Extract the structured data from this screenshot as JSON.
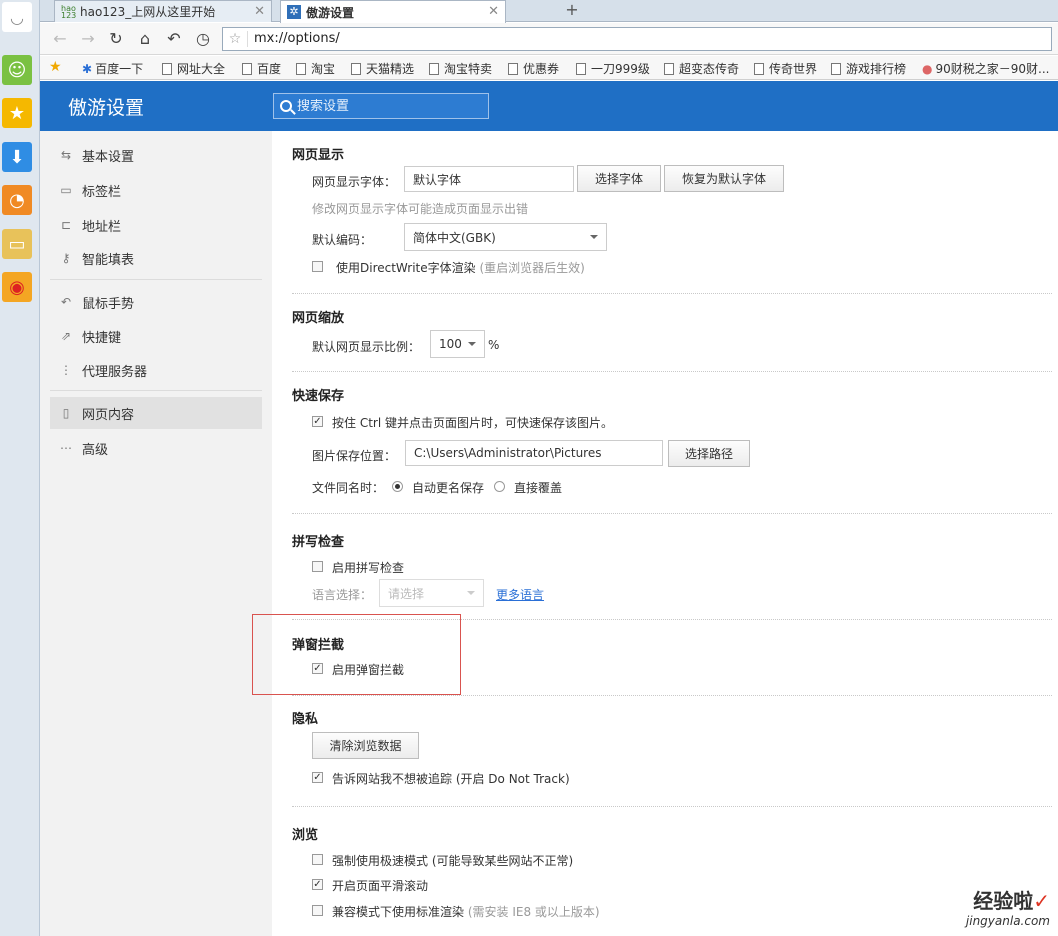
{
  "tabs": [
    {
      "label": "hao123_上网从这里开始",
      "icon": "hao123-icon"
    },
    {
      "label": "傲游设置",
      "icon": "maxthon-settings-icon"
    }
  ],
  "address": {
    "url": "mx://options/"
  },
  "bookmarks": [
    "百度一下",
    "网址大全",
    "百度",
    "淘宝",
    "天猫精选",
    "淘宝特卖",
    "优惠券",
    "一刀999级",
    "超变态传奇",
    "传奇世界",
    "游戏排行榜",
    "90财税之家－90财..."
  ],
  "header": {
    "title": "傲游设置",
    "search_placeholder": "搜索设置"
  },
  "sidebar": {
    "items": [
      {
        "label": "基本设置",
        "icon": "sliders-icon"
      },
      {
        "label": "标签栏",
        "icon": "tabs-icon"
      },
      {
        "label": "地址栏",
        "icon": "address-icon"
      },
      {
        "label": "智能填表",
        "icon": "key-icon"
      },
      {
        "label": "鼠标手势",
        "icon": "gesture-icon"
      },
      {
        "label": "快捷键",
        "icon": "shortcut-icon"
      },
      {
        "label": "代理服务器",
        "icon": "proxy-icon"
      },
      {
        "label": "网页内容",
        "icon": "page-icon"
      },
      {
        "label": "高级",
        "icon": "more-icon"
      }
    ]
  },
  "display": {
    "title": "网页显示",
    "font_label": "网页显示字体：",
    "font_value": "默认字体",
    "choose_font": "选择字体",
    "reset_font": "恢复为默认字体",
    "font_hint": "修改网页显示字体可能造成页面显示出错",
    "encoding_label": "默认编码：",
    "encoding_value": "简体中文(GBK)",
    "directwrite_label": "使用DirectWrite字体渲染",
    "directwrite_hint": "(重启浏览器后生效)"
  },
  "zoom": {
    "title": "网页缩放",
    "label": "默认网页显示比例：",
    "value": "100",
    "unit": "%"
  },
  "quicksave": {
    "title": "快速保存",
    "ctrl_label": "按住 Ctrl 键并点击页面图片时，可快速保存该图片。",
    "path_label": "图片保存位置：",
    "path_value": "C:\\Users\\Administrator\\Pictures",
    "choose_path": "选择路径",
    "dup_label": "文件同名时：",
    "dup_auto": "自动更名保存",
    "dup_overwrite": "直接覆盖"
  },
  "spell": {
    "title": "拼写检查",
    "enable_label": "启用拼写检查",
    "lang_label": "语言选择：",
    "lang_placeholder": "请选择",
    "more_lang": "更多语言"
  },
  "popup": {
    "title": "弹窗拦截",
    "enable_label": "启用弹窗拦截"
  },
  "privacy": {
    "title": "隐私",
    "clear_button": "清除浏览数据",
    "dnt_label": "告诉网站我不想被追踪 (开启 Do Not Track)"
  },
  "browse": {
    "title": "浏览",
    "turbo_label": "强制使用极速模式 (可能导致某些网站不正常)",
    "smooth_label": "开启页面平滑滚动",
    "compat_label": "兼容模式下使用标准渲染",
    "compat_hint": "(需安装 IE8 或以上版本)"
  },
  "watermark": {
    "title": "经验啦",
    "url": "jingyanla.com"
  },
  "colors": {
    "header": "#1f6fc5",
    "highlight_box": "#d9534f",
    "link": "#2a6fd6"
  }
}
